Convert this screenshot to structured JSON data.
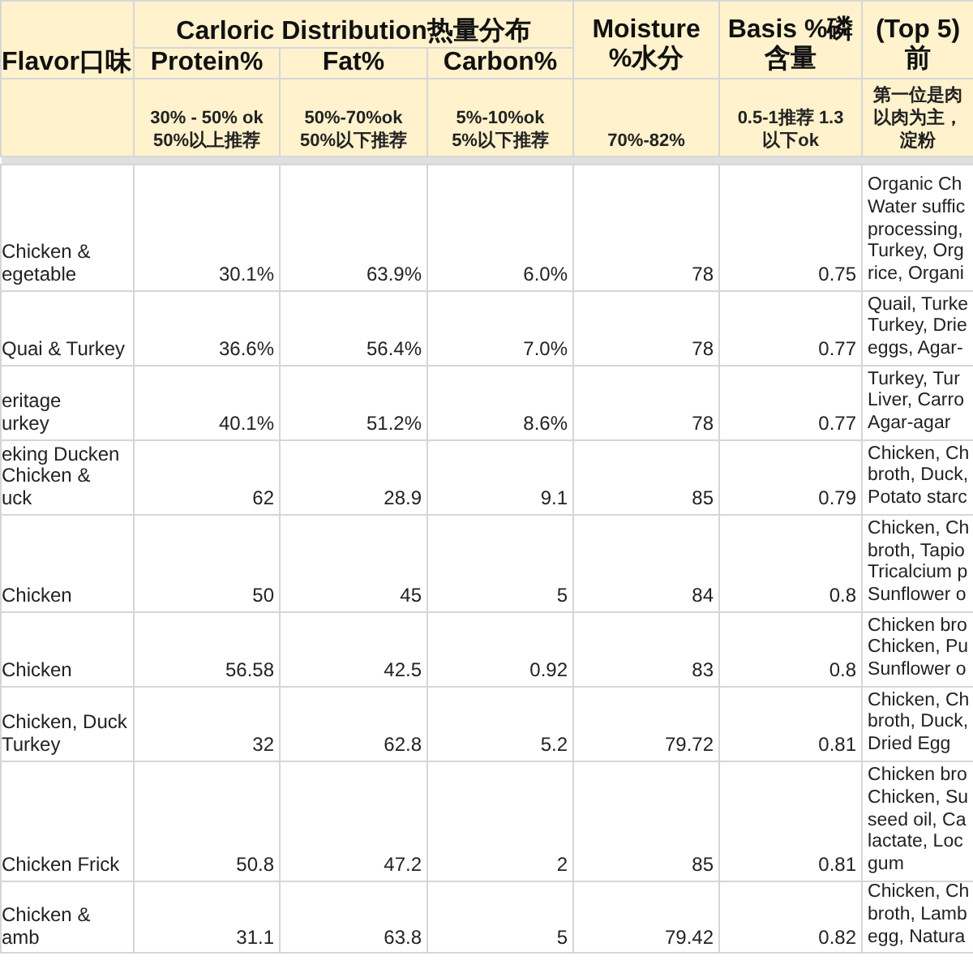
{
  "header": {
    "flavor": "Flavor口味",
    "group": "Carloric Distribution热量分布",
    "protein": "Protein%",
    "fat": "Fat%",
    "carbon": "Carbon%",
    "moisture": [
      "Moisture",
      "%水分"
    ],
    "phosphorus": [
      "Basis %磷",
      "含量"
    ],
    "ingredients": [
      "(Top 5)",
      "前"
    ]
  },
  "notes": [
    [
      "30% - 50% ok",
      "50%以上推荐"
    ],
    [
      "50%-70%ok",
      "50%以下推荐"
    ],
    [
      "5%-10%ok",
      "5%以下推荐"
    ],
    [
      "70%-82%"
    ],
    [
      "0.5-1推荐 1.3",
      "以下ok"
    ],
    [
      "第一位是肉",
      "以肉为主，",
      "淀粉"
    ]
  ],
  "rows": [
    {
      "cells": [
        "Chicken &\negetable",
        "30.1%",
        "63.9%",
        "6.0%",
        "78",
        "0.75",
        "Organic Ch\nWater suffic\nprocessing,\nTurkey, Org\nrice, Organi"
      ]
    },
    {
      "cells": [
        "Quai & Turkey",
        "36.6%",
        "56.4%",
        "7.0%",
        "78",
        "0.77",
        "Quail, Turke\nTurkey, Drie\neggs, Agar-"
      ]
    },
    {
      "cells": [
        "eritage\nurkey",
        "40.1%",
        "51.2%",
        "8.6%",
        "78",
        "0.77",
        "Turkey, Tur\nLiver, Carro\nAgar-agar"
      ]
    },
    {
      "cells": [
        "eking Ducken\nChicken &\nuck",
        "62",
        "28.9",
        "9.1",
        "85",
        "0.79",
        "Chicken, Ch\nbroth, Duck,\nPotato starc"
      ]
    },
    {
      "cells": [
        "Chicken",
        "50",
        "45",
        "5",
        "84",
        "0.8",
        "Chicken, Ch\nbroth, Tapio\nTricalcium p\nSunflower o"
      ]
    },
    {
      "cells": [
        "Chicken",
        "56.58",
        "42.5",
        "0.92",
        "83",
        "0.8",
        "Chicken bro\nChicken, Pu\nSunflower o"
      ]
    },
    {
      "cells": [
        "Chicken, Duck\nTurkey",
        "32",
        "62.8",
        "5.2",
        "79.72",
        "0.81",
        "Chicken, Ch\nbroth, Duck,\nDried Egg"
      ]
    },
    {
      "cells": [
        "Chicken Frick",
        "50.8",
        "47.2",
        "2",
        "85",
        "0.81",
        "Chicken bro\nChicken, Su\nseed oil, Ca\nlactate, Loc\ngum"
      ]
    },
    {
      "cells": [
        "Chicken &\namb",
        "31.1",
        "63.8",
        "5",
        "79.42",
        "0.82",
        "Chicken, Ch\nbroth, Lamb\negg, Natura"
      ]
    }
  ]
}
